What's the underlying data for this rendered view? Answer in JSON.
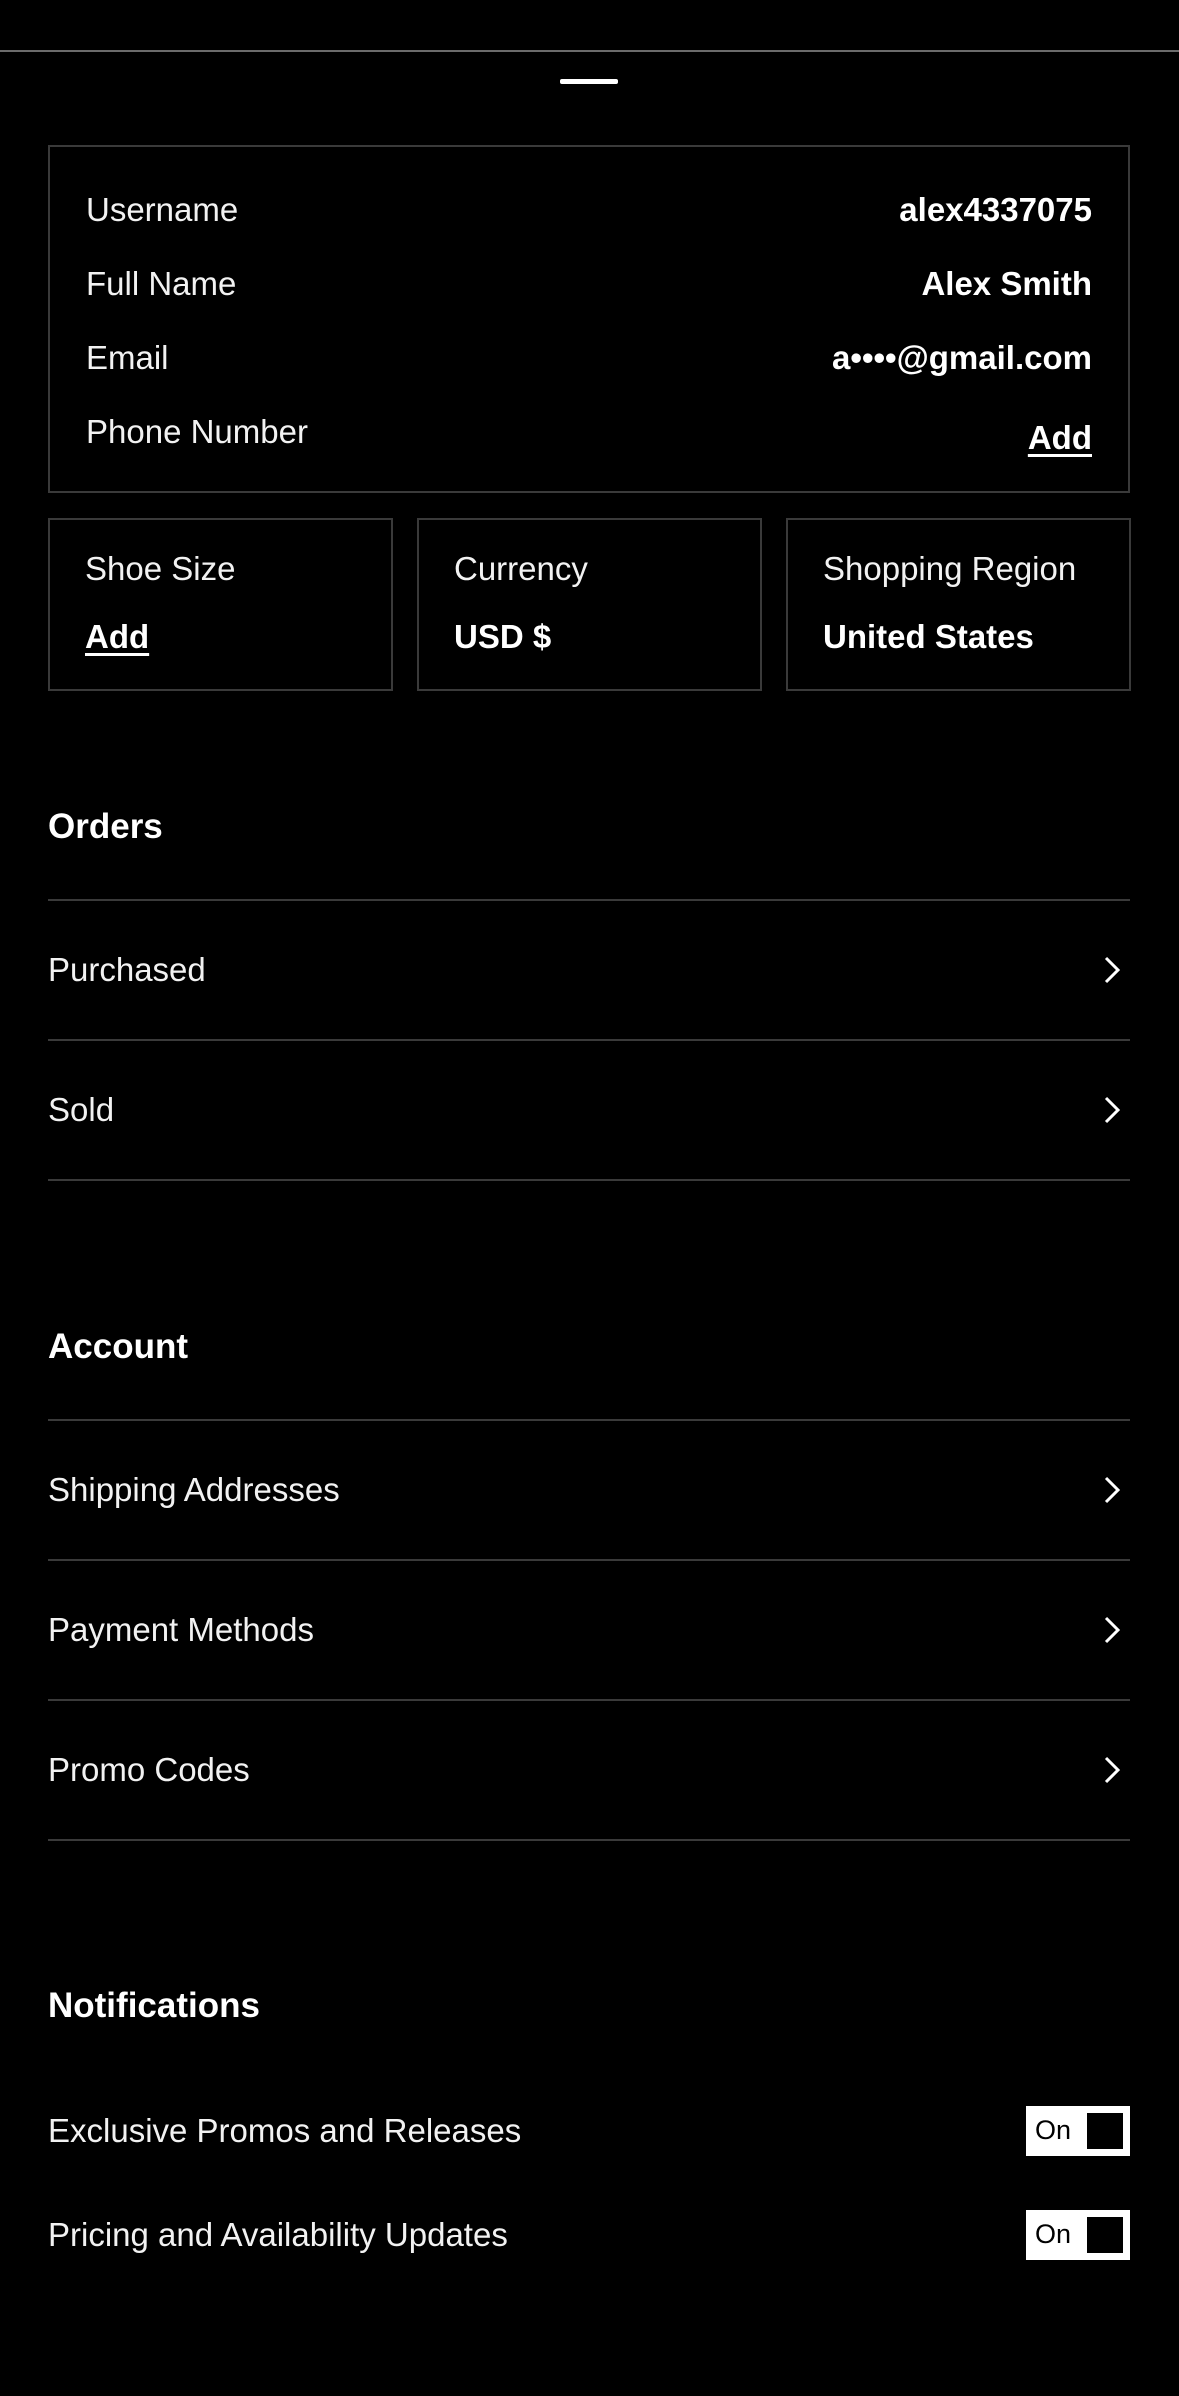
{
  "profile": {
    "username_label": "Username",
    "username_value": "alex4337075",
    "fullname_label": "Full Name",
    "fullname_value": "Alex Smith",
    "email_label": "Email",
    "email_value": "a••••@gmail.com",
    "phone_label": "Phone Number",
    "phone_action": "Add"
  },
  "preferences": {
    "shoe_size_label": "Shoe Size",
    "shoe_size_action": "Add",
    "currency_label": "Currency",
    "currency_value": "USD $",
    "region_label": "Shopping Region",
    "region_value": "United States"
  },
  "orders": {
    "title": "Orders",
    "items": [
      {
        "label": "Purchased"
      },
      {
        "label": "Sold"
      }
    ]
  },
  "account": {
    "title": "Account",
    "items": [
      {
        "label": "Shipping Addresses"
      },
      {
        "label": "Payment Methods"
      },
      {
        "label": "Promo Codes"
      }
    ]
  },
  "notifications": {
    "title": "Notifications",
    "items": [
      {
        "label": "Exclusive Promos and Releases",
        "state": "On"
      },
      {
        "label": "Pricing and Availability Updates",
        "state": "On"
      }
    ]
  },
  "icons": {
    "chevron": "chevron-right-icon"
  },
  "colors": {
    "background": "#000000",
    "text": "#ffffff",
    "border": "#3a3a3a"
  }
}
